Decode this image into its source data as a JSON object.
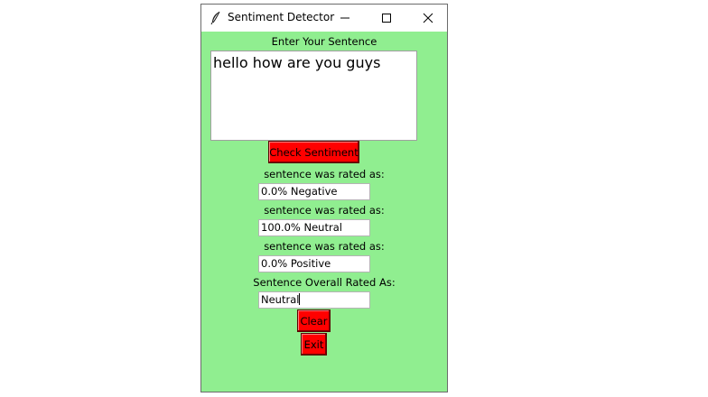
{
  "window": {
    "title": "Sentiment Detector",
    "background_color": "#90ee90"
  },
  "titlebar": {
    "app_icon": "feather-icon",
    "minimize_icon": "minimize-icon",
    "maximize_icon": "maximize-icon",
    "close_icon": "close-icon"
  },
  "form": {
    "input_label": "Enter Your Sentence",
    "input_text": "hello how are you guys",
    "check_button": "Check Sentiment",
    "negative_label": "sentence was rated as:",
    "negative_value": "0.0% Negative",
    "neutral_label": "sentence was rated as:",
    "neutral_value": "100.0% Neutral",
    "positive_label": "sentence was rated as:",
    "positive_value": "0.0% Positive",
    "overall_label": "Sentence Overall Rated As:",
    "overall_value": "Neutral",
    "clear_button": "Clear",
    "exit_button": "Exit",
    "button_color": "#ff0000"
  }
}
